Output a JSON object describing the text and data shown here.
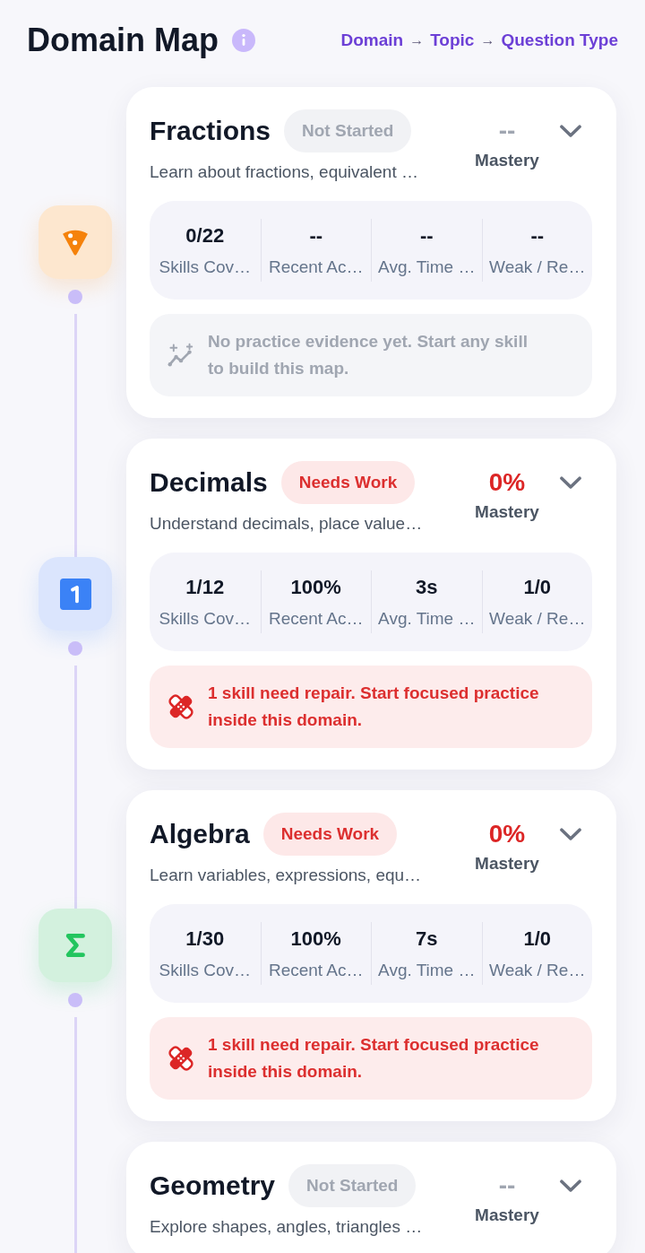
{
  "header": {
    "title": "Domain Map",
    "hierarchy": {
      "levels": [
        "Domain",
        "Topic",
        "Question Type"
      ],
      "separator": "→"
    }
  },
  "domains": [
    {
      "name": "Fractions",
      "status": {
        "kind": "not_started",
        "label": "Not Started"
      },
      "mastery": {
        "value": "--",
        "label": "Mastery"
      },
      "expanded": false,
      "description": "Learn about fractions, equivalent …",
      "tile": {
        "kind": "pizza"
      },
      "stats": [
        {
          "value": "0/22",
          "label": "Skills Cov…"
        },
        {
          "value": "--",
          "label": "Recent Ac…"
        },
        {
          "value": "--",
          "label": "Avg. Time …"
        },
        {
          "value": "--",
          "label": "Weak / Re…"
        }
      ],
      "notice": {
        "kind": "empty",
        "text": "No practice evidence yet. Start any skill to build this map."
      }
    },
    {
      "name": "Decimals",
      "status": {
        "kind": "needs_work",
        "label": "Needs Work"
      },
      "mastery": {
        "value": "0%",
        "label": "Mastery"
      },
      "expanded": false,
      "description": "Understand decimals, place value…",
      "tile": {
        "kind": "keycap"
      },
      "stats": [
        {
          "value": "1/12",
          "label": "Skills Cov…"
        },
        {
          "value": "100%",
          "label": "Recent Ac…"
        },
        {
          "value": "3s",
          "label": "Avg. Time …"
        },
        {
          "value": "1/0",
          "label": "Weak / Re…"
        }
      ],
      "notice": {
        "kind": "repair",
        "text": "1 skill need repair. Start focused practice inside this domain."
      }
    },
    {
      "name": "Algebra",
      "status": {
        "kind": "needs_work",
        "label": "Needs Work"
      },
      "mastery": {
        "value": "0%",
        "label": "Mastery"
      },
      "expanded": false,
      "description": "Learn variables, expressions, equ…",
      "tile": {
        "kind": "sigma"
      },
      "stats": [
        {
          "value": "1/30",
          "label": "Skills Cov…"
        },
        {
          "value": "100%",
          "label": "Recent Ac…"
        },
        {
          "value": "7s",
          "label": "Avg. Time …"
        },
        {
          "value": "1/0",
          "label": "Weak / Re…"
        }
      ],
      "notice": {
        "kind": "repair",
        "text": "1 skill need repair. Start focused practice inside this domain."
      }
    },
    {
      "name": "Geometry",
      "status": {
        "kind": "not_started",
        "label": "Not Started"
      },
      "mastery": {
        "value": "--",
        "label": "Mastery"
      },
      "expanded": false,
      "description": "Explore shapes, angles, triangles …"
    }
  ]
}
